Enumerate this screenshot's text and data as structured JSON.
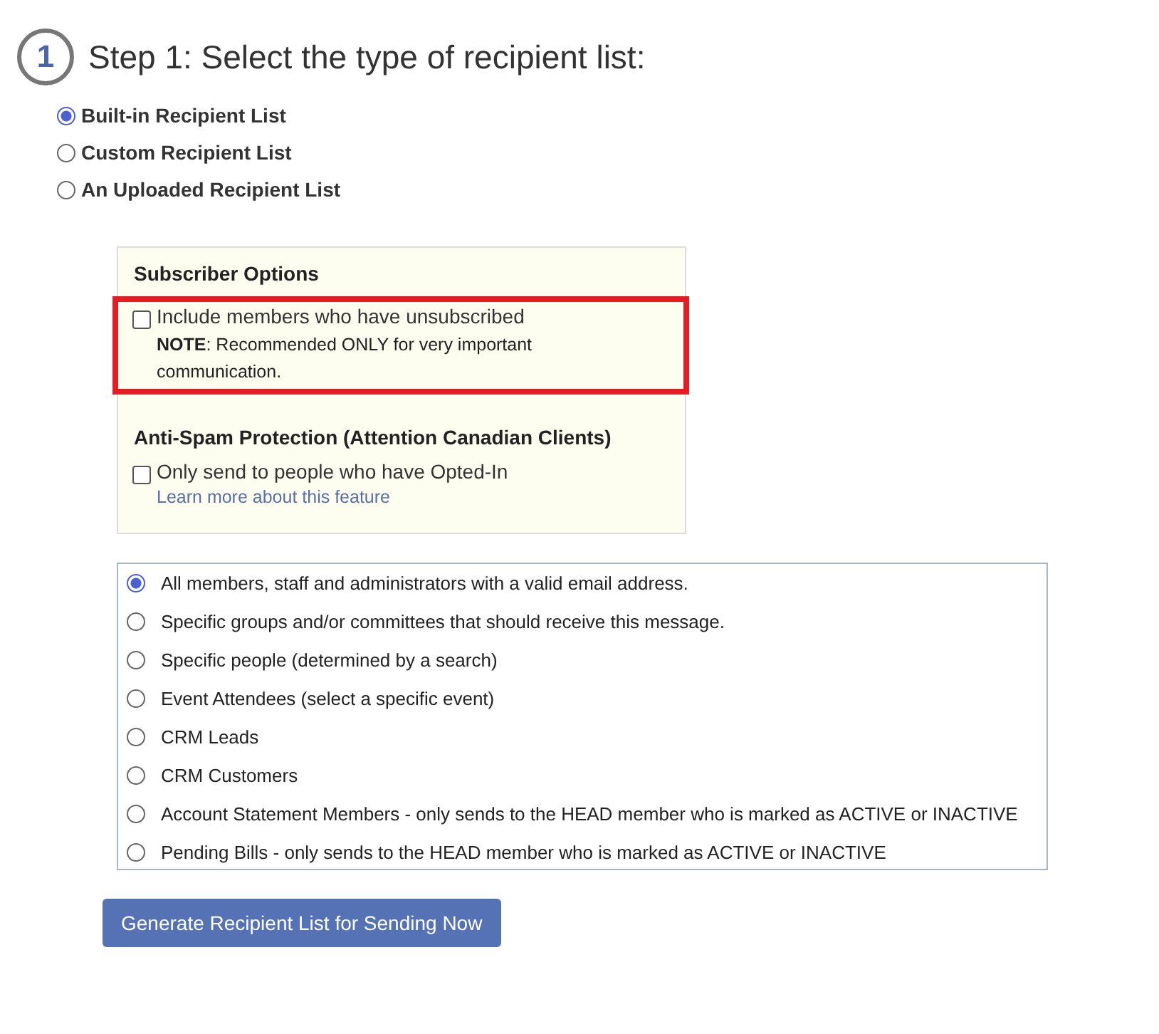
{
  "step": {
    "number": "1",
    "title": "Step 1: Select the type of recipient list:"
  },
  "list_types": [
    {
      "label": "Built-in Recipient List",
      "selected": true
    },
    {
      "label": "Custom Recipient List",
      "selected": false
    },
    {
      "label": "An Uploaded Recipient List",
      "selected": false
    }
  ],
  "options_panel": {
    "sections": [
      {
        "heading": "Subscriber Options",
        "highlighted": true,
        "option": {
          "label": "Include members who have unsubscribed",
          "checked": false,
          "note": "**NOTE**: Recommended ONLY for very important communication."
        }
      },
      {
        "heading": "Anti-Spam Protection (Attention Canadian Clients)",
        "highlighted": false,
        "option": {
          "label": "Only send to people who have Opted-In",
          "checked": false,
          "link": "Learn more about this feature"
        }
      }
    ]
  },
  "recipients": [
    {
      "label": "All members, staff and administrators with a valid email address.",
      "selected": true
    },
    {
      "label": "Specific groups and/or committees that should receive this message.",
      "selected": false
    },
    {
      "label": "Specific people (determined by a search)",
      "selected": false
    },
    {
      "label": "Event Attendees (select a specific event)",
      "selected": false
    },
    {
      "label": "CRM Leads",
      "selected": false
    },
    {
      "label": "CRM Customers",
      "selected": false
    },
    {
      "label": "Account Statement Members - only sends to the HEAD member who is marked as ACTIVE or INACTIVE",
      "selected": false
    },
    {
      "label": "Pending Bills - only sends to the HEAD member who is marked as ACTIVE or INACTIVE",
      "selected": false
    }
  ],
  "button": "Generate Recipient List for Sending Now"
}
